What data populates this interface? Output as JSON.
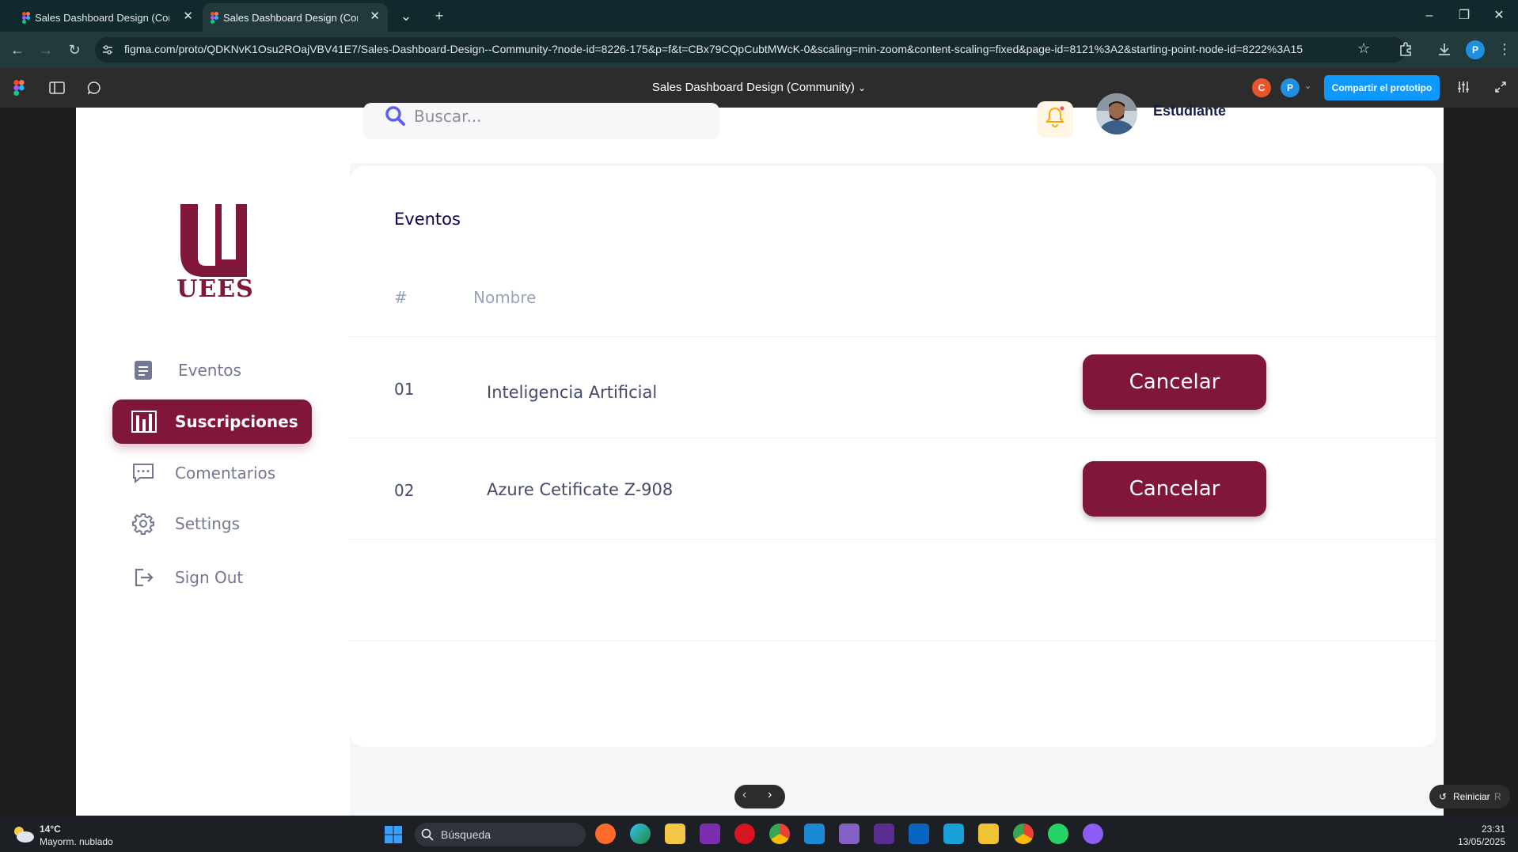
{
  "browser": {
    "tabs": [
      {
        "title": "Sales Dashboard Design (Comm",
        "active": false
      },
      {
        "title": "Sales Dashboard Design (Comm",
        "active": true
      }
    ],
    "url": "figma.com/proto/QDKNvK1Osu2ROajVBV41E7/Sales-Dashboard-Design--Community-?node-id=8226-175&p=f&t=CBx79CQpCubtMWcK-0&scaling=min-zoom&content-scaling=fixed&page-id=8121%3A2&starting-point-node-id=8222%3A15",
    "profile_initial": "P"
  },
  "figma": {
    "title": "Sales Dashboard Design (Community)",
    "collaborators": [
      {
        "initial": "C",
        "color": "#e8552a"
      },
      {
        "initial": "P",
        "color": "#1f8fe0"
      }
    ],
    "share_label": "Compartir el prototipo",
    "restart_label": "Reiniciar",
    "restart_shortcut": "R"
  },
  "app": {
    "brand_colors": {
      "primary": "#801639",
      "bell": "#ffa800"
    },
    "logo_text": "UEES",
    "search_placeholder": "Buscar...",
    "user_role": "Estudiante",
    "nav": [
      {
        "label": "Eventos",
        "icon": "document-icon",
        "active": false
      },
      {
        "label": "Suscripciones",
        "icon": "bar-chart-icon",
        "active": true
      },
      {
        "label": "Comentarios",
        "icon": "chat-icon",
        "active": false
      },
      {
        "label": "Settings",
        "icon": "gear-icon",
        "active": false
      },
      {
        "label": "Sign Out",
        "icon": "sign-out-icon",
        "active": false
      }
    ],
    "card_title": "Eventos",
    "columns": [
      "#",
      "Nombre"
    ],
    "rows": [
      {
        "num": "01",
        "name": "Inteligencia Artificial",
        "action": "Cancelar"
      },
      {
        "num": "02",
        "name": "Azure Cetificate Z-908",
        "action": "Cancelar"
      }
    ]
  },
  "taskbar": {
    "weather_temp": "14°C",
    "weather_desc": "Mayorm. nublado",
    "search_label": "Búsqueda",
    "time": "23:31",
    "date": "13/05/2025"
  }
}
